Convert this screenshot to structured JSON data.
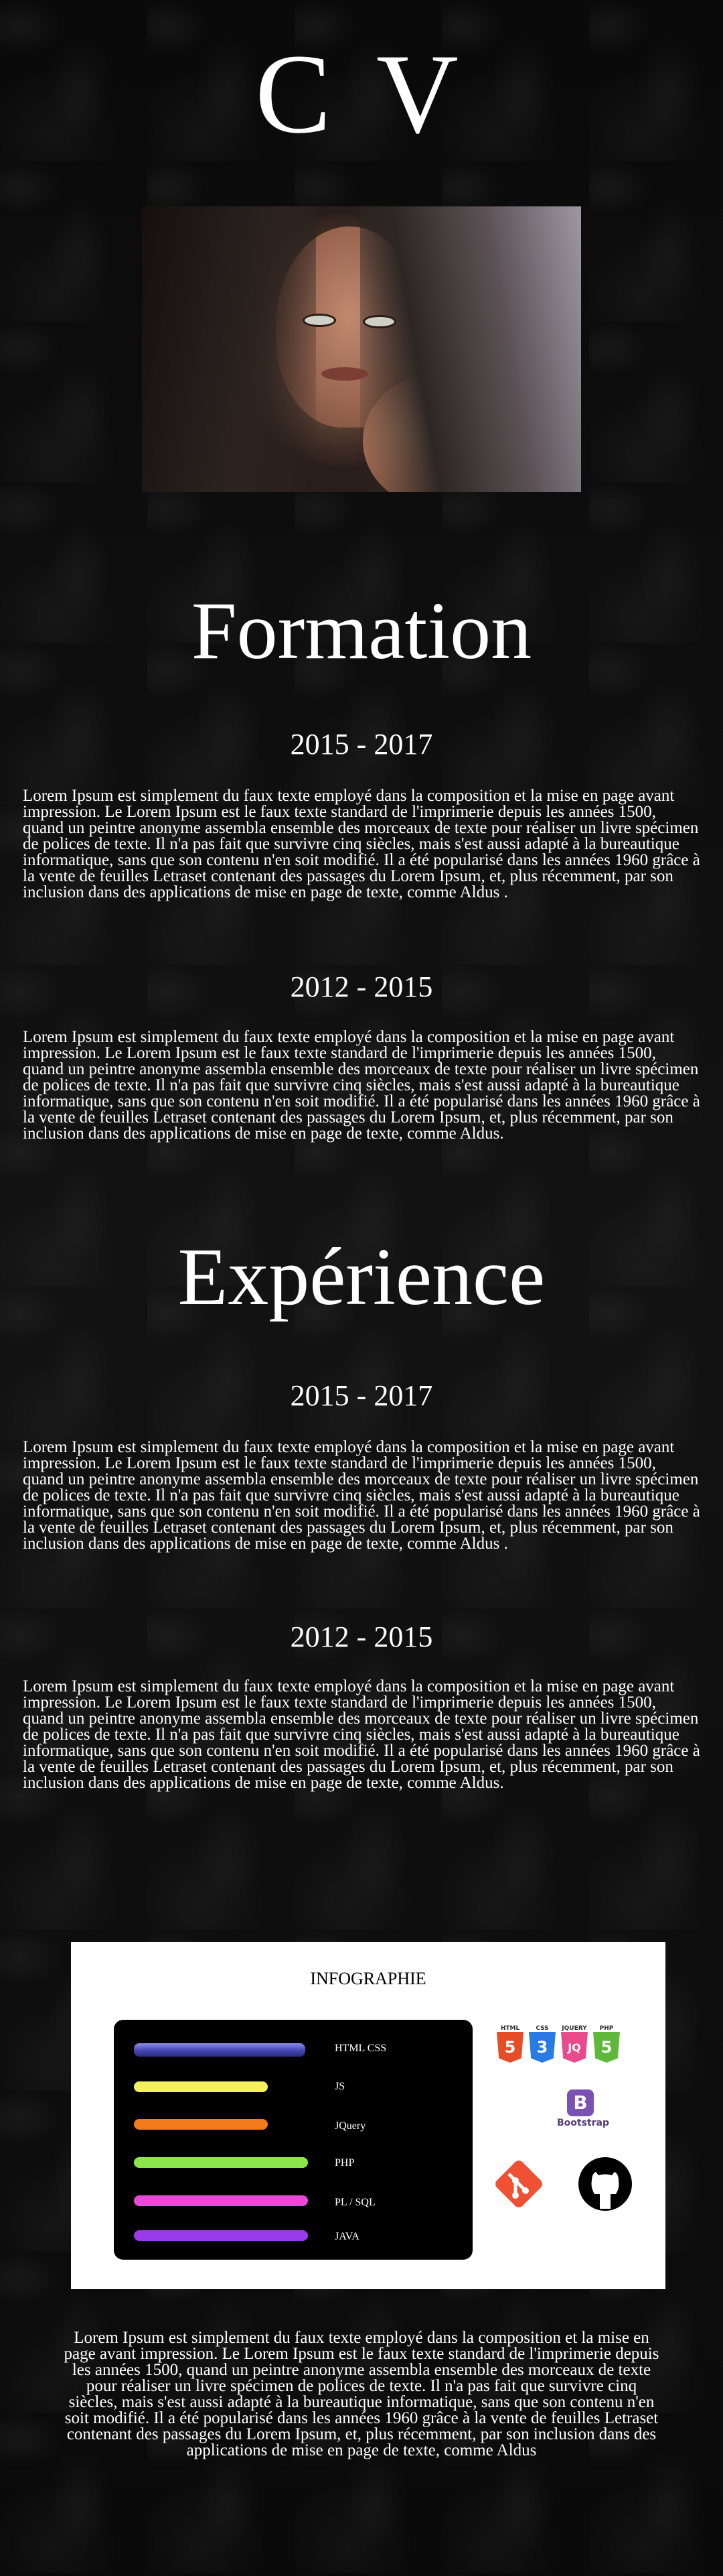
{
  "header": {
    "title": "C V"
  },
  "formation": {
    "title": "Formation",
    "entries": [
      {
        "years": "2015 - 2017",
        "text": "Lorem Ipsum est simplement du faux texte employé dans la composition et la mise en page avant impression. Le Lorem Ipsum est le faux texte standard de l'imprimerie depuis les années 1500, quand un peintre anonyme assembla ensemble des morceaux de texte pour réaliser un livre spécimen de polices de texte. Il n'a pas fait que survivre cinq siècles, mais s'est aussi adapté à la bureautique informatique, sans que son contenu n'en soit modifié. Il a été popularisé dans les années 1960 grâce à la vente de feuilles Letraset contenant des passages du Lorem Ipsum, et, plus récemment, par son inclusion dans des applications de mise en page de texte, comme Aldus ."
      },
      {
        "years": "2012 - 2015",
        "text": "Lorem Ipsum est simplement du faux texte employé dans la composition et la mise en page avant impression. Le Lorem Ipsum est le faux texte standard de l'imprimerie depuis les années 1500, quand un peintre anonyme assembla ensemble des morceaux de texte pour réaliser un livre spécimen de polices de texte. Il n'a pas fait que survivre cinq siècles, mais s'est aussi adapté à la bureautique informatique, sans que son contenu n'en soit modifié. Il a été popularisé dans les années 1960 grâce à la vente de feuilles Letraset contenant des passages du Lorem Ipsum, et, plus récemment, par son inclusion dans des applications de mise en page de texte, comme Aldus."
      }
    ]
  },
  "experience": {
    "title": "Expérience",
    "entries": [
      {
        "years": "2015 - 2017",
        "text": "Lorem Ipsum est simplement du faux texte employé dans la composition et la mise en page avant impression. Le Lorem Ipsum est le faux texte standard de l'imprimerie depuis les années 1500, quand un peintre anonyme assembla ensemble des morceaux de texte pour réaliser un livre spécimen de polices de texte. Il n'a pas fait que survivre cinq siècles, mais s'est aussi adapté à la bureautique informatique, sans que son contenu n'en soit modifié. Il a été popularisé dans les années 1960 grâce à la vente de feuilles Letraset contenant des passages du Lorem Ipsum, et, plus récemment, par son inclusion dans des applications de mise en page de texte, comme Aldus ."
      },
      {
        "years": "2012 - 2015",
        "text": "Lorem Ipsum est simplement du faux texte employé dans la composition et la mise en page avant impression. Le Lorem Ipsum est le faux texte standard de l'imprimerie depuis les années 1500, quand un peintre anonyme assembla ensemble des morceaux de texte pour réaliser un livre spécimen de polices de texte. Il n'a pas fait que survivre cinq siècles, mais s'est aussi adapté à la bureautique informatique, sans que son contenu n'en soit modifié. Il a été popularisé dans les années 1960 grâce à la vente de feuilles Letraset contenant des passages du Lorem Ipsum, et, plus récemment, par son inclusion dans des applications de mise en page de texte, comme Aldus."
      }
    ]
  },
  "infographic": {
    "title": "INFOGRAPHIE",
    "skills": [
      {
        "label": "HTML   CSS",
        "color": "#4a4ab8"
      },
      {
        "label": "JS",
        "color": "#f4f15a"
      },
      {
        "label": "JQuery",
        "color": "#f27a1a"
      },
      {
        "label": "PHP",
        "color": "#8ae64a"
      },
      {
        "label": "PL / SQL",
        "color": "#e84ad8"
      },
      {
        "label": "JAVA",
        "color": "#9a3ae8"
      }
    ],
    "logos": {
      "html5": {
        "caption": "HTML",
        "glyph": "5",
        "color": "#e44d26"
      },
      "css3": {
        "caption": "CSS",
        "glyph": "3",
        "color": "#2a7ae4"
      },
      "jquery": {
        "caption": "JQUERY",
        "glyph": "JQ",
        "color": "#e84a8a"
      },
      "php": {
        "caption": "PHP",
        "glyph": "5",
        "color": "#5fb83a"
      },
      "bootstrap": {
        "caption": "Bootstrap",
        "glyph": "B",
        "color": "#7952b3"
      },
      "git": {
        "icon": "git-icon",
        "color": "#f05033"
      },
      "github": {
        "icon": "github-icon",
        "color": "#000000"
      }
    }
  },
  "footer": {
    "text": "Lorem Ipsum est simplement du faux texte employé dans la composition et la mise en page avant impression. Le Lorem Ipsum est le faux texte standard de l'imprimerie depuis les années 1500, quand un peintre anonyme assembla ensemble des morceaux de texte pour réaliser un livre spécimen de polices de texte. Il n'a pas fait que survivre cinq siècles, mais s'est aussi adapté à la bureautique informatique, sans que son contenu n'en soit modifié. Il a été popularisé dans les années 1960 grâce à la vente de feuilles Letraset contenant des passages du Lorem Ipsum, et, plus récemment, par son inclusion dans des applications de mise en page de texte, comme Aldus"
  }
}
